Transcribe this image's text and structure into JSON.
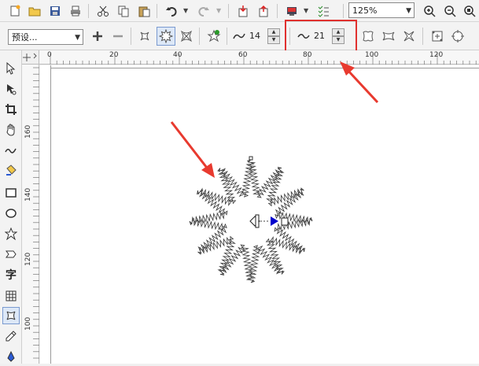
{
  "toolbar": {
    "zoom_value": "125%"
  },
  "property_bar": {
    "preset_value": "预设...",
    "points_value": "14",
    "complexity_value": "21"
  },
  "ruler": {
    "top_labels": [
      "0",
      "20",
      "40",
      "60",
      "80",
      "100",
      "120"
    ],
    "left_labels": [
      "160",
      "140",
      "120",
      "100"
    ]
  },
  "toolbox": {
    "text_tool_label": "字"
  },
  "colors": {
    "highlight": "#e0312f",
    "arrow": "#e83a2f",
    "handle_blue": "#0000cc"
  }
}
